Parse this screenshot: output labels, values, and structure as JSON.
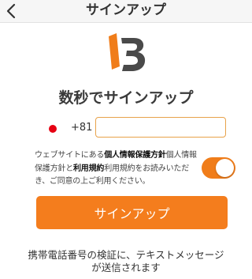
{
  "nav": {
    "title": "サインアップ",
    "back_icon": "chevron-left-icon"
  },
  "logo": {
    "icon": "brand-b-logo-icon",
    "colors": {
      "accent": "#f07d1a",
      "dark": "#4a4a4a"
    }
  },
  "headline": "数秒でサインアップ",
  "phone": {
    "flag_icon": "japan-flag-icon",
    "country_code": "+81",
    "value": "",
    "placeholder": ""
  },
  "consent": {
    "prefix": "ウェブサイトにある",
    "privacy_link": "個人情報保護方針",
    "middle": "個人情報保護方針と",
    "terms_link": "利用規約",
    "suffix": "利用規約をお読みいただき、ご同意の上ご利用ください。",
    "toggle_on": true
  },
  "signup_button": {
    "label": "サインアップ"
  },
  "footer": {
    "line1": "携帯電話番号の検証に、テキストメッセージ",
    "line2": "が送信されます"
  },
  "colors": {
    "accent": "#f47d1d",
    "input_border": "#e8a24a",
    "flag_red": "#e60012"
  }
}
